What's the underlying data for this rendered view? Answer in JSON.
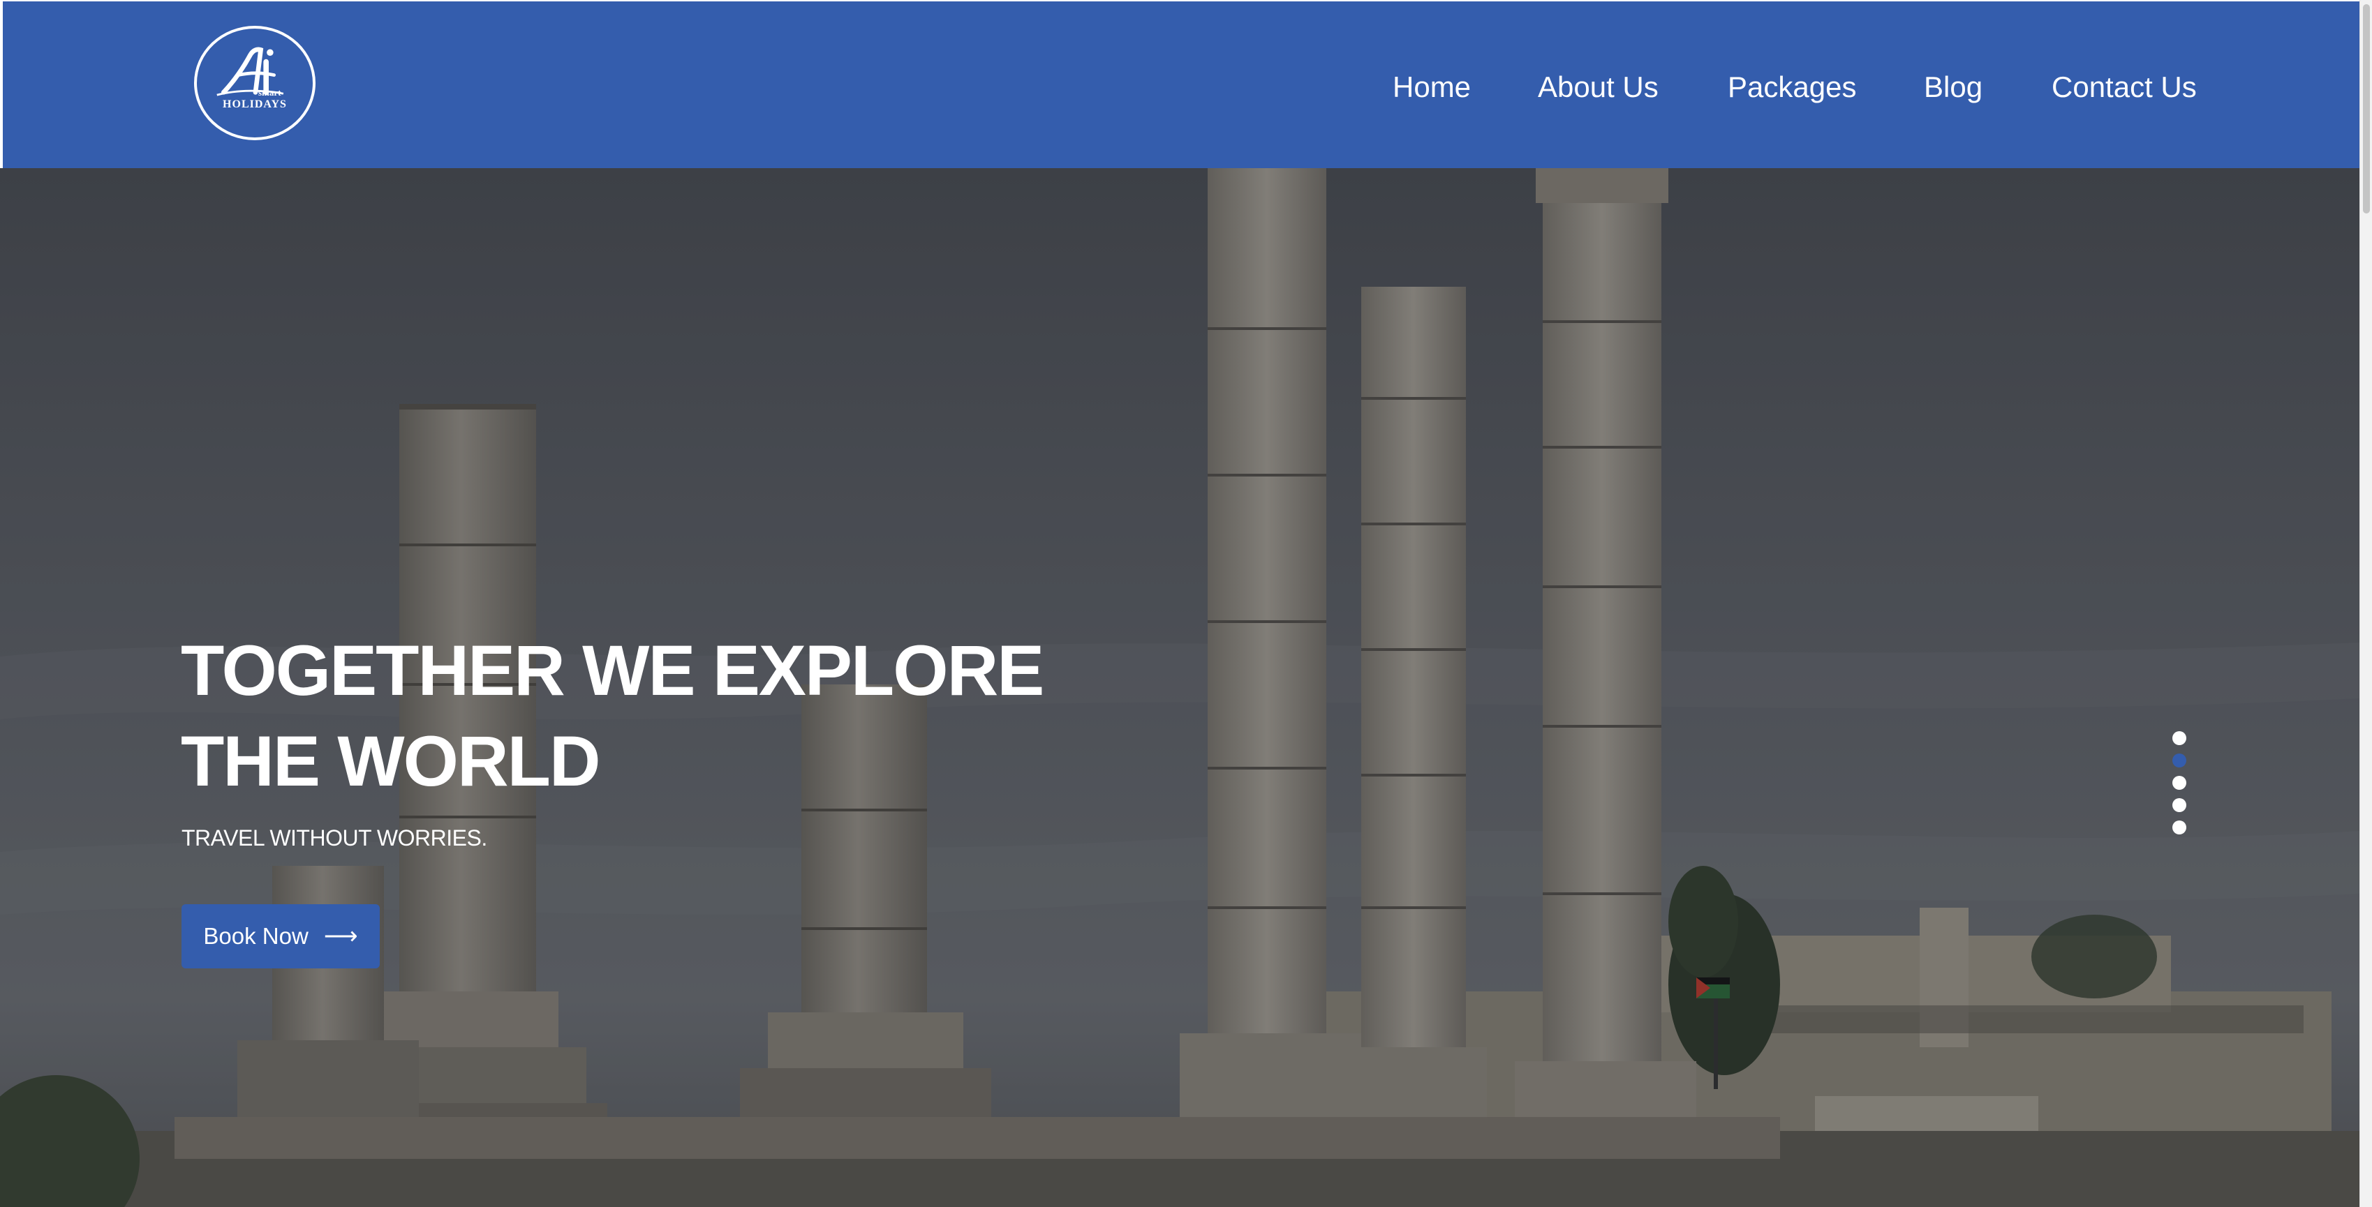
{
  "brand": {
    "logo_initials": "Ai",
    "logo_word_small": "smart",
    "logo_word": "HOLIDAYS"
  },
  "nav": {
    "items": [
      "Home",
      "About Us",
      "Packages",
      "Blog",
      "Contact Us"
    ]
  },
  "hero": {
    "title_line1": "TOGETHER WE EXPLORE",
    "title_line2": "THE WORLD",
    "subtitle": "TRAVEL WITHOUT WORRIES.",
    "cta_label": "Book Now",
    "cta_icon": "arrow-right-icon",
    "slides_count": 5,
    "active_slide": 2
  },
  "colors": {
    "brand_blue": "#345DAD",
    "text_white": "#FFFFFF"
  }
}
